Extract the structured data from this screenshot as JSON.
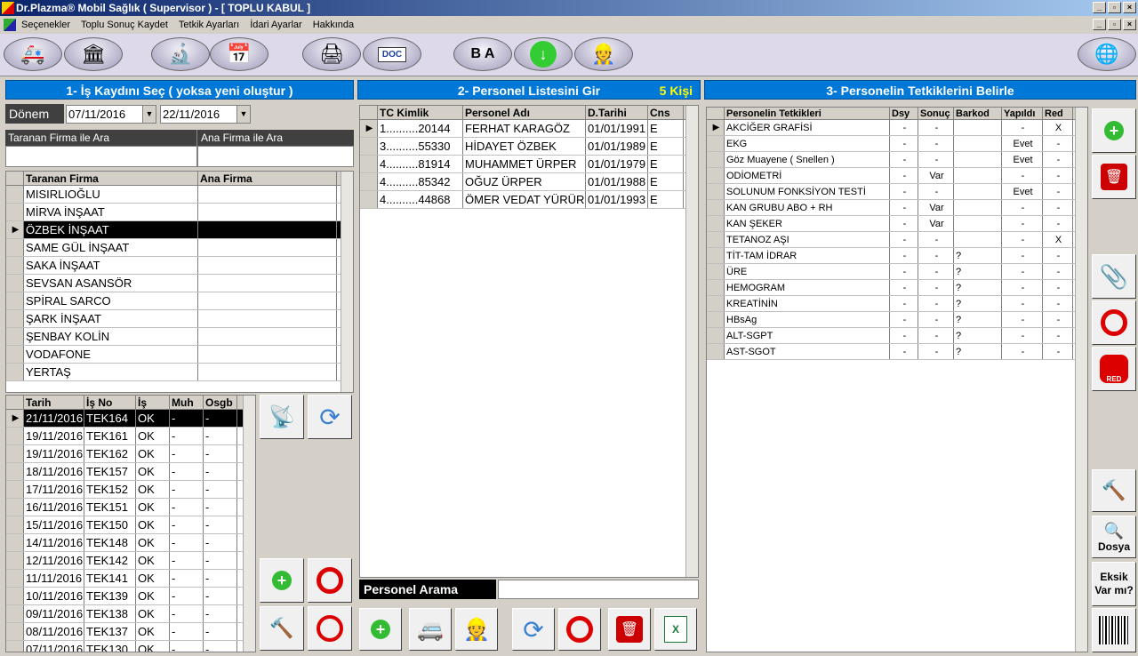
{
  "window": {
    "title": "Dr.Plazma® Mobil Sağlık ( Supervisor ) - [ TOPLU KABUL ]"
  },
  "menu": [
    "Seçenekler",
    "Toplu Sonuç Kaydet",
    "Tetkik Ayarları",
    "İdari Ayarlar",
    "Hakkında"
  ],
  "panel1": {
    "title": "1- İş Kaydını Seç ( yoksa yeni oluştur )",
    "donem_label": "Dönem",
    "date_from": "07/11/2016",
    "date_to": "22/11/2016",
    "search_taranan_label": "Taranan Firma ile Ara",
    "search_ana_label": "Ana Firma ile Ara",
    "firm_headers": [
      "Taranan Firma",
      "Ana Firma"
    ],
    "firms": [
      "MISIRLIOĞLU",
      "MİRVA İNŞAAT",
      "ÖZBEK İNŞAAT",
      "SAME GÜL İNŞAAT",
      "SAKA İNŞAAT",
      "SEVSAN ASANSÖR",
      "SPİRAL SARCO",
      "ŞARK İNŞAAT",
      "ŞENBAY KOLİN",
      "VODAFONE",
      "YERTAŞ"
    ],
    "job_headers": [
      "Tarih",
      "İş No",
      "İş",
      "Muh",
      "Osgb"
    ],
    "jobs": [
      [
        "21/11/2016",
        "TEK164",
        "OK",
        "-",
        "-"
      ],
      [
        "19/11/2016",
        "TEK161",
        "OK",
        "-",
        "-"
      ],
      [
        "19/11/2016",
        "TEK162",
        "OK",
        "-",
        "-"
      ],
      [
        "18/11/2016",
        "TEK157",
        "OK",
        "-",
        "-"
      ],
      [
        "17/11/2016",
        "TEK152",
        "OK",
        "-",
        "-"
      ],
      [
        "16/11/2016",
        "TEK151",
        "OK",
        "-",
        "-"
      ],
      [
        "15/11/2016",
        "TEK150",
        "OK",
        "-",
        "-"
      ],
      [
        "14/11/2016",
        "TEK148",
        "OK",
        "-",
        "-"
      ],
      [
        "12/11/2016",
        "TEK142",
        "OK",
        "-",
        "-"
      ],
      [
        "11/11/2016",
        "TEK141",
        "OK",
        "-",
        "-"
      ],
      [
        "10/11/2016",
        "TEK139",
        "OK",
        "-",
        "-"
      ],
      [
        "09/11/2016",
        "TEK138",
        "OK",
        "-",
        "-"
      ],
      [
        "08/11/2016",
        "TEK137",
        "OK",
        "-",
        "-"
      ],
      [
        "07/11/2016",
        "TEK130",
        "OK",
        "-",
        "-"
      ]
    ]
  },
  "panel2": {
    "title": "2- Personel Listesini Gir",
    "count": "5 Kişi",
    "headers": [
      "TC Kimlik",
      "Personel Adı",
      "D.Tarihi",
      "Cns"
    ],
    "rows": [
      [
        "1..........20144",
        "FERHAT KARAGÖZ",
        "01/01/1991",
        "E"
      ],
      [
        "3..........55330",
        "HİDAYET ÖZBEK",
        "01/01/1989",
        "E"
      ],
      [
        "4..........81914",
        "MUHAMMET ÜRPER",
        "01/01/1979",
        "E"
      ],
      [
        "4..........85342",
        "OĞUZ ÜRPER",
        "01/01/1988",
        "E"
      ],
      [
        "4..........44868",
        "ÖMER VEDAT YÜRÜR",
        "01/01/1993",
        "E"
      ]
    ],
    "search_label": "Personel Arama"
  },
  "panel3": {
    "title": "3- Personelin Tetkiklerini Belirle",
    "headers": [
      "Personelin Tetkikleri",
      "Dsy",
      "Sonuç",
      "Barkod",
      "Yapıldı",
      "Red"
    ],
    "rows": [
      [
        "AKCİĞER GRAFİSİ",
        "-",
        "-",
        "",
        "-",
        "X"
      ],
      [
        "EKG",
        "-",
        "-",
        "",
        "Evet",
        "-"
      ],
      [
        "Göz Muayene ( Snellen )",
        "-",
        "-",
        "",
        "Evet",
        "-"
      ],
      [
        "ODİOMETRİ",
        "-",
        "Var",
        "",
        "-",
        "-"
      ],
      [
        "SOLUNUM FONKSİYON TESTİ",
        "-",
        "-",
        "",
        "Evet",
        "-"
      ],
      [
        "KAN GRUBU ABO + RH",
        "-",
        "Var",
        "",
        "-",
        "-"
      ],
      [
        "KAN ŞEKER",
        "-",
        "Var",
        "",
        "-",
        "-"
      ],
      [
        "TETANOZ AŞI",
        "-",
        "-",
        "",
        "-",
        "X"
      ],
      [
        "TİT-TAM İDRAR",
        "-",
        "-",
        "?",
        "-",
        "-"
      ],
      [
        "ÜRE",
        "-",
        "-",
        "?",
        "-",
        "-"
      ],
      [
        "HEMOGRAM",
        "-",
        "-",
        "?",
        "-",
        "-"
      ],
      [
        "KREATİNİN",
        "-",
        "-",
        "?",
        "-",
        "-"
      ],
      [
        "HBsAg",
        "-",
        "-",
        "?",
        "-",
        "-"
      ],
      [
        "ALT-SGPT",
        "-",
        "-",
        "?",
        "-",
        "-"
      ],
      [
        "AST-SGOT",
        "-",
        "-",
        "?",
        "-",
        "-"
      ]
    ]
  },
  "side": {
    "dosya": "Dosya",
    "eksik": "Eksik Var mı?",
    "red": "RED"
  },
  "toolbar_doc": "DOC",
  "colors": {
    "header_blue": "#0078d7",
    "count_yellow": "#ffff00",
    "title_dark": "#0a246a"
  }
}
